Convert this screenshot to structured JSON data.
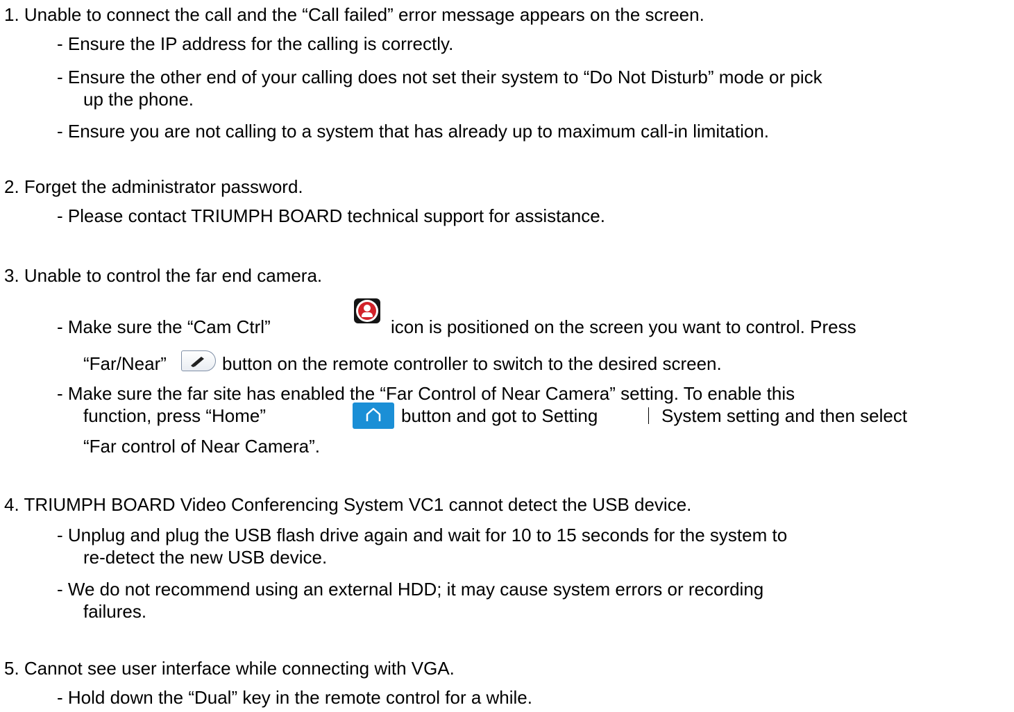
{
  "items": [
    {
      "title": "1. Unable to connect the call and the “Call failed” error message appears on the screen.",
      "bullets": [
        "- Ensure the IP address for the calling is correctly.",
        "- Ensure the other end of your calling does not set their system to “Do Not Disturb” mode or pick",
        "up the phone.",
        "- Ensure you are not calling to a system that has already up to maximum call-in limitation."
      ]
    },
    {
      "title": "2. Forget the administrator password.",
      "bullets": [
        "- Please contact TRIUMPH BOARD technical support for assistance."
      ]
    },
    {
      "title": "3. Unable to control the far end camera.",
      "bullets": [
        "- Make sure the “Cam Ctrl”",
        "icon is positioned on the screen you want to control. Press",
        "“Far/Near”",
        "button on the remote controller to switch to the desired screen.",
        "- Make sure the far site has enabled the “Far Control of Near Camera” setting. To enable this",
        "function, press “Home”",
        "button and got to Setting",
        "System setting and then select",
        "“Far control of Near Camera”."
      ]
    },
    {
      "title": "4.  TRIUMPH BOARD Video Conferencing System VC1 cannot detect the USB device.",
      "bullets": [
        "- Unplug and plug the USB flash drive again and wait for 10 to 15 seconds for the system to",
        "re-detect the new USB device.",
        "- We do not recommend using an external HDD; it may cause system errors or recording",
        "failures."
      ]
    },
    {
      "title": "5. Cannot see user interface while connecting with VGA.",
      "bullets": [
        "- Hold down the “Dual” key in the remote control for a while."
      ]
    }
  ],
  "icons": {
    "cam_ctrl": "cam-ctrl-icon",
    "far_near": "far-near-button-icon",
    "home": "home-button-icon"
  },
  "colors": {
    "cam_red": "#d2232a",
    "home_blue": "#1b8fd6"
  }
}
